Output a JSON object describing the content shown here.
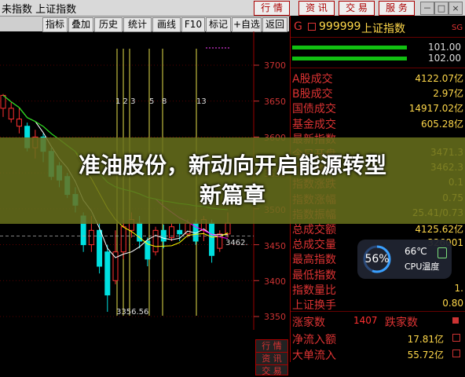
{
  "window": {
    "title": "未指数 上证指数"
  },
  "topbar": {
    "buttons": [
      "行 情",
      "资 讯",
      "交 易",
      "服 务"
    ],
    "win_controls": [
      "－",
      "□",
      "×"
    ]
  },
  "toolbar": {
    "buttons": [
      "指标",
      "叠加",
      "历史",
      "统计",
      "画线",
      "F10",
      "标记",
      "+自选",
      "返回"
    ]
  },
  "chart": {
    "y_ticks": [
      "3700",
      "3650",
      "3600",
      "3550",
      "3500",
      "3450",
      "3400",
      "3350"
    ],
    "annotations": [
      "1 2 3",
      "5",
      "8",
      "13"
    ],
    "last_price_label": "3462.",
    "low_label": "3356.56",
    "candles": [
      {
        "o": 3640,
        "c": 3658,
        "h": 3660,
        "l": 3628,
        "up": true
      },
      {
        "o": 3625,
        "c": 3640,
        "h": 3648,
        "l": 3620,
        "up": true
      },
      {
        "o": 3615,
        "c": 3625,
        "h": 3640,
        "l": 3605,
        "up": true
      },
      {
        "o": 3615,
        "c": 3585,
        "h": 3620,
        "l": 3580,
        "up": false
      },
      {
        "o": 3585,
        "c": 3600,
        "h": 3610,
        "l": 3570,
        "up": true
      },
      {
        "o": 3600,
        "c": 3580,
        "h": 3605,
        "l": 3565,
        "up": false
      },
      {
        "o": 3580,
        "c": 3545,
        "h": 3585,
        "l": 3540,
        "up": false
      },
      {
        "o": 3560,
        "c": 3540,
        "h": 3565,
        "l": 3530,
        "up": false
      },
      {
        "o": 3545,
        "c": 3520,
        "h": 3550,
        "l": 3515,
        "up": false
      },
      {
        "o": 3520,
        "c": 3505,
        "h": 3530,
        "l": 3495,
        "up": false
      },
      {
        "o": 3490,
        "c": 3450,
        "h": 3495,
        "l": 3440,
        "up": false
      },
      {
        "o": 3450,
        "c": 3470,
        "h": 3490,
        "l": 3440,
        "up": true
      },
      {
        "o": 3470,
        "c": 3420,
        "h": 3480,
        "l": 3410,
        "up": false
      },
      {
        "o": 3440,
        "c": 3380,
        "h": 3450,
        "l": 3356.56,
        "up": false
      },
      {
        "o": 3400,
        "c": 3440,
        "h": 3470,
        "l": 3395,
        "up": true
      },
      {
        "o": 3440,
        "c": 3475,
        "h": 3485,
        "l": 3430,
        "up": true
      },
      {
        "o": 3470,
        "c": 3485,
        "h": 3495,
        "l": 3460,
        "up": true
      },
      {
        "o": 3480,
        "c": 3455,
        "h": 3490,
        "l": 3445,
        "up": false
      },
      {
        "o": 3455,
        "c": 3430,
        "h": 3460,
        "l": 3420,
        "up": false
      },
      {
        "o": 3440,
        "c": 3470,
        "h": 3475,
        "l": 3435,
        "up": true
      },
      {
        "o": 3470,
        "c": 3455,
        "h": 3478,
        "l": 3445,
        "up": false
      },
      {
        "o": 3460,
        "c": 3475,
        "h": 3480,
        "l": 3455,
        "up": true
      },
      {
        "o": 3470,
        "c": 3465,
        "h": 3480,
        "l": 3455,
        "up": false
      },
      {
        "o": 3465,
        "c": 3480,
        "h": 3485,
        "l": 3460,
        "up": true
      },
      {
        "o": 3480,
        "c": 3455,
        "h": 3485,
        "l": 3450,
        "up": false
      },
      {
        "o": 3470,
        "c": 3485,
        "h": 3490,
        "l": 3455,
        "up": true
      },
      {
        "o": 3480,
        "c": 3435,
        "h": 3485,
        "l": 3425,
        "up": false
      },
      {
        "o": 3445,
        "c": 3465,
        "h": 3470,
        "l": 3440,
        "up": true
      },
      {
        "o": 3465,
        "c": 3480,
        "h": 3495,
        "l": 3460,
        "up": true
      }
    ]
  },
  "panel": {
    "code": "999999",
    "name": "上证指数",
    "marker": "G",
    "sg": "SG",
    "buy_sell": [
      "101.00",
      "102.00"
    ],
    "rows": [
      {
        "label": "A股成交",
        "value": "4122.07亿"
      },
      {
        "label": "B股成交",
        "value": "2.97亿"
      },
      {
        "label": "国债成交",
        "value": "14917.02亿"
      },
      {
        "label": "基金成交",
        "value": "605.28亿"
      },
      {
        "label": "最新指数",
        "value": ""
      },
      {
        "label": "今日开盘",
        "value": "3471.3"
      },
      {
        "label": "昨日收盘",
        "value": "3462.3"
      },
      {
        "label": "指数涨跌",
        "value": "0.1"
      },
      {
        "label": "指数涨幅",
        "value": "0.75"
      },
      {
        "label": "指数振幅",
        "value": "25.41/0.73"
      },
      {
        "label": "总成交额",
        "value": "4125.62亿"
      },
      {
        "label": "总成交量",
        "value": "326001"
      },
      {
        "label": "最高指数",
        "value": ""
      },
      {
        "label": "最低指数",
        "value": ""
      },
      {
        "label": "指数量比",
        "value": "1."
      },
      {
        "label": "上证换手",
        "value": "0.80"
      }
    ],
    "bottom_rows": [
      {
        "label": "涨家数",
        "value": "1407",
        "label2": "跌家数",
        "value2": ""
      },
      {
        "label": "净流入额",
        "value": "17.81亿"
      },
      {
        "label": "大单流入",
        "value": "55.72亿"
      }
    ]
  },
  "bottom_tabs": [
    "行 情",
    "资 讯",
    "交 易"
  ],
  "headline": {
    "line1": "准油股份，新动向开启能源转型",
    "line2": "新篇章"
  },
  "widget": {
    "percent": "56%",
    "percent_value": 56,
    "temp": "66℃",
    "label": "CPU温度"
  },
  "colors": {
    "up": "#ff3030",
    "down": "#00e0e0",
    "ma5": "#ffffff",
    "ma10": "#ffff00",
    "ma20": "#ff00ff",
    "ma60": "#00ff00",
    "accent": "#cc0000"
  }
}
